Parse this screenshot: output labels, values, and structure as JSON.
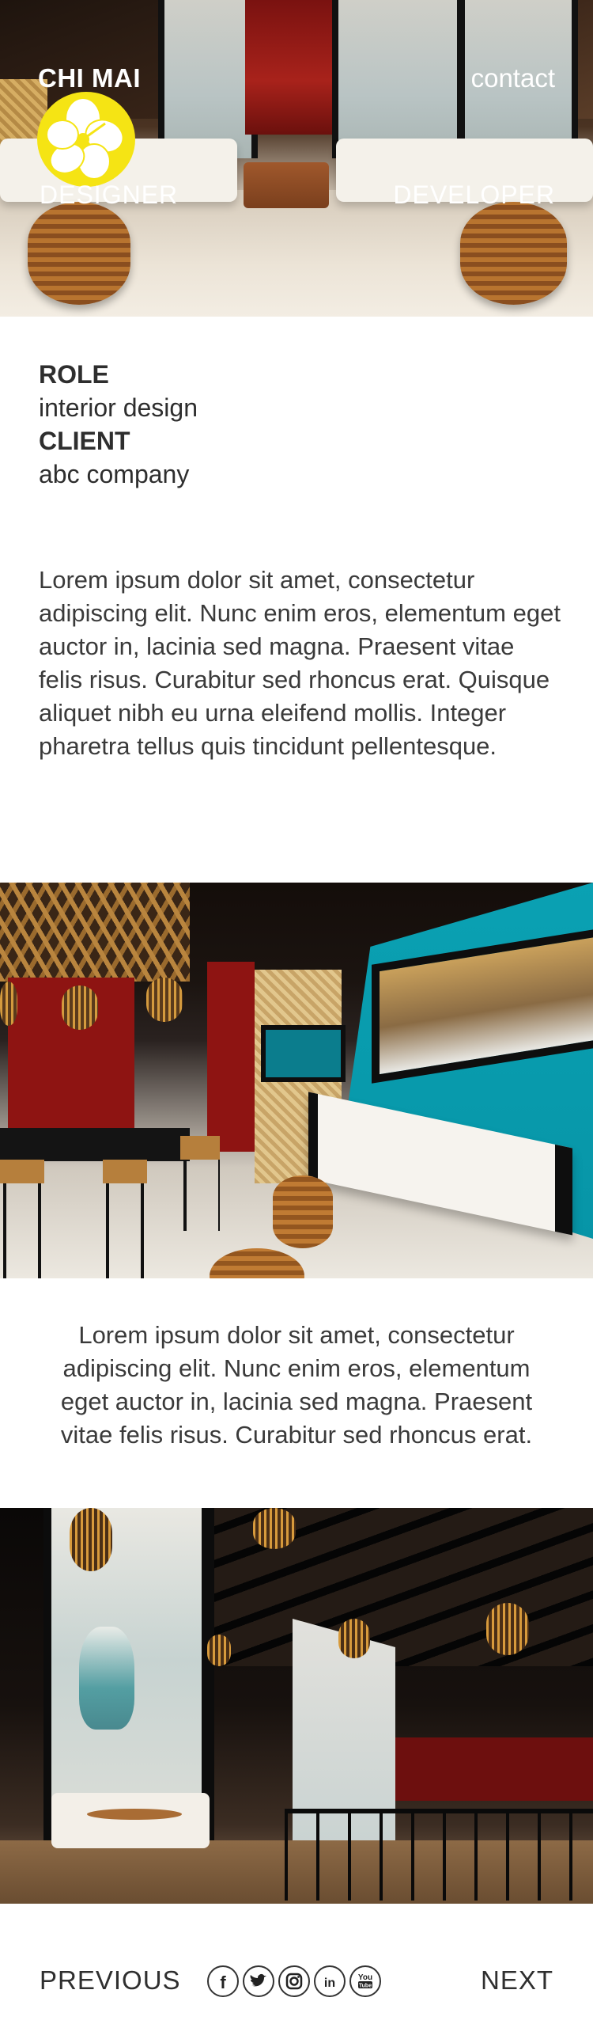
{
  "header": {
    "name": "CHI MAI",
    "contact": "contact",
    "designer": "DESIGNER",
    "developer": "DEVELOPER"
  },
  "meta": {
    "role_label": "ROLE",
    "role_value": "interior design",
    "client_label": "CLIENT",
    "client_value": "abc company"
  },
  "content": {
    "paragraph_1": "Lorem ipsum dolor sit amet, consectetur adipiscing elit. Nunc enim eros, elementum eget auctor in, lacinia sed magna. Praesent vitae felis risus. Curabitur sed rhoncus erat. Quisque aliquet nibh eu urna eleifend mollis. Integer pharetra tellus quis tincidunt pellentesque.",
    "paragraph_2": "Lorem ipsum dolor sit amet, consectetur adipiscing elit. Nunc enim eros, elementum eget auctor in, lacinia sed magna. Praesent vitae felis risus. Curabitur sed rhoncus erat."
  },
  "footer": {
    "previous": "PREVIOUS",
    "next": "NEXT",
    "social": [
      "facebook-icon",
      "twitter-icon",
      "instagram-icon",
      "linkedin-icon",
      "youtube-icon"
    ]
  },
  "colors": {
    "logo_yellow": "#f5e414",
    "text": "#2e2e2e",
    "accent_teal": "#0aa1b3"
  }
}
